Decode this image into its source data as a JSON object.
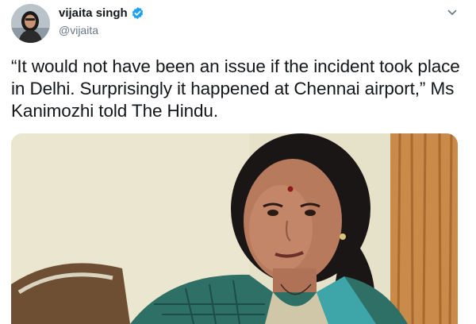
{
  "tweet": {
    "display_name": "vijaita singh",
    "handle": "@vijaita",
    "verified": true,
    "text": "“It would not have been an issue if the incident took place in Delhi. Surprisingly it happened at Chennai airport,” Ms Kanimozhi told The Hindu.",
    "icons": {
      "avatar": "profile-photo",
      "verified": "verified-badge-icon",
      "menu": "chevron-down-icon"
    },
    "media": {
      "type": "photo"
    }
  },
  "colors": {
    "verified": "#1da1f2",
    "handle": "#657786",
    "text": "#14171a"
  }
}
